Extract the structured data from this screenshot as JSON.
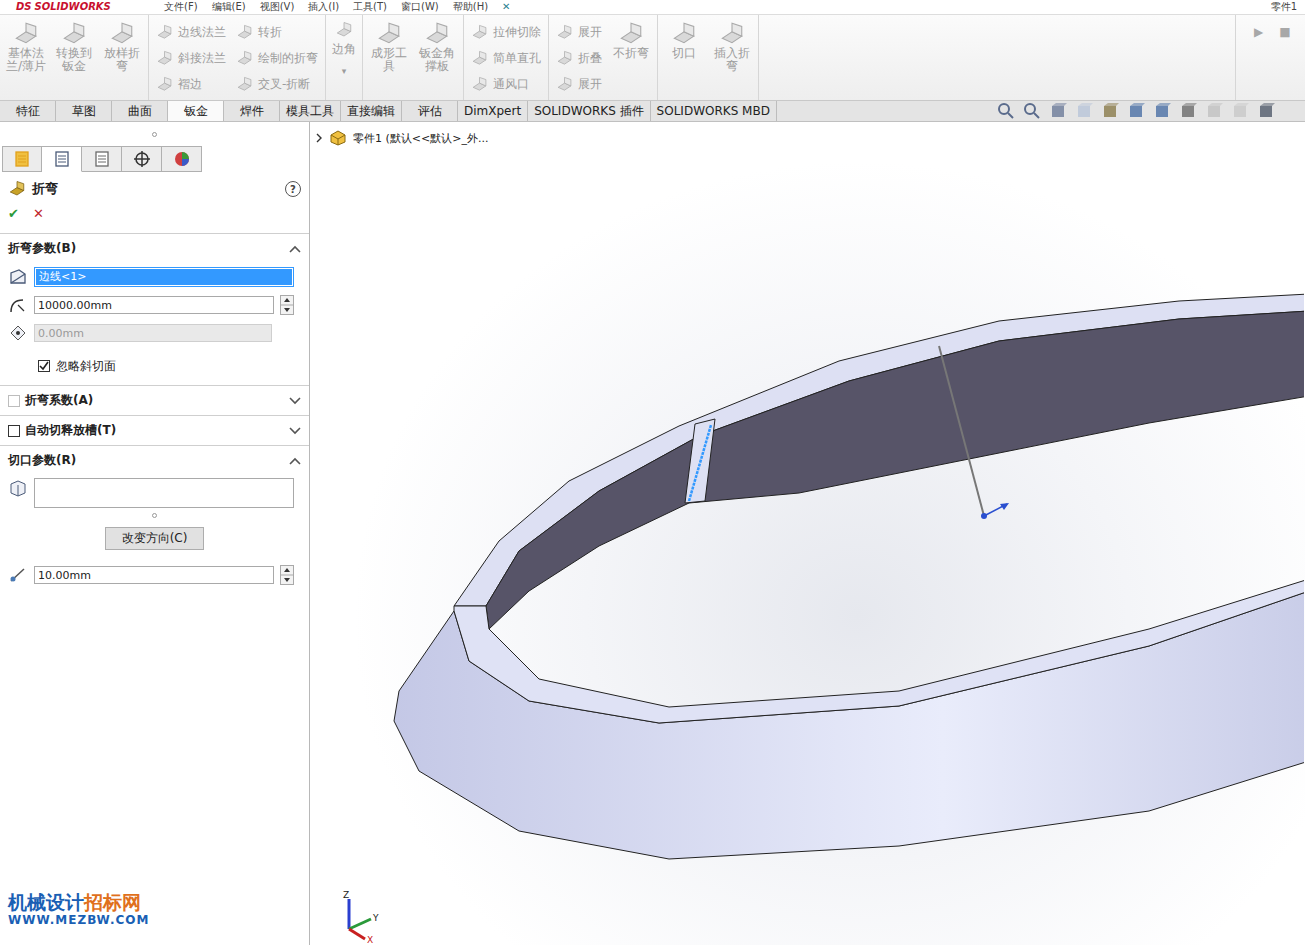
{
  "titlebar": {
    "logo_mark": "DS",
    "logo": "SOLIDWORKS",
    "menu": [
      "文件(F)",
      "编辑(E)",
      "视图(V)",
      "插入(I)",
      "工具(T)",
      "窗口(W)",
      "帮助(H)"
    ],
    "pin": "✕",
    "document": "零件1"
  },
  "ribbon": {
    "sections": [
      [
        {
          "kind": "large",
          "label": "基体法兰/薄片",
          "disabled": true
        },
        {
          "kind": "large",
          "label": "转换到钣金",
          "disabled": true
        },
        {
          "kind": "large",
          "label": "放样折弯",
          "disabled": true
        }
      ],
      [
        {
          "kind": "stack",
          "items": [
            {
              "label": "边线法兰",
              "disabled": true
            },
            {
              "label": "斜接法兰",
              "disabled": true
            },
            {
              "label": "褶边",
              "disabled": true
            }
          ]
        },
        {
          "kind": "stack",
          "items": [
            {
              "label": "转折",
              "disabled": true
            },
            {
              "label": "绘制的折弯",
              "disabled": true
            },
            {
              "label": "交叉-折断",
              "disabled": true
            }
          ]
        }
      ],
      [
        {
          "kind": "dropdown",
          "label": "边角",
          "arrow": "▾",
          "disabled": true
        }
      ],
      [
        {
          "kind": "large",
          "label": "成形工具",
          "disabled": true
        },
        {
          "kind": "large",
          "label": "钣金角撑板",
          "disabled": true
        }
      ],
      [
        {
          "kind": "stack",
          "items": [
            {
              "label": "拉伸切除",
              "disabled": true
            },
            {
              "label": "简单直孔",
              "disabled": true
            },
            {
              "label": "通风口",
              "disabled": true
            }
          ]
        }
      ],
      [
        {
          "kind": "stack",
          "items": [
            {
              "label": "展开",
              "disabled": true
            },
            {
              "label": "折叠",
              "disabled": true
            },
            {
              "label": "展开",
              "disabled": true
            }
          ]
        },
        {
          "kind": "large",
          "label": "不折弯",
          "disabled": true
        }
      ],
      [
        {
          "kind": "large",
          "label": "切口",
          "disabled": true
        },
        {
          "kind": "large",
          "label": "插入折弯",
          "disabled": true
        }
      ]
    ],
    "macro": {
      "play": "▶",
      "stop": "■"
    }
  },
  "tabs": [
    {
      "label": "特征",
      "selected": false
    },
    {
      "label": "草图",
      "selected": false
    },
    {
      "label": "曲面",
      "selected": false
    },
    {
      "label": "钣金",
      "selected": true
    },
    {
      "label": "焊件",
      "selected": false
    },
    {
      "label": "模具工具",
      "selected": false
    },
    {
      "label": "直接编辑",
      "selected": false
    },
    {
      "label": "评估",
      "selected": false
    },
    {
      "label": "DimXpert",
      "selected": false
    },
    {
      "label": "SOLIDWORKS 插件",
      "selected": false
    },
    {
      "label": "SOLIDWORKS MBD",
      "selected": false
    }
  ],
  "property_manager": {
    "tabs": [
      {
        "selected": false
      },
      {
        "selected": true
      },
      {
        "selected": false
      },
      {
        "selected": false
      },
      {
        "selected": false
      }
    ],
    "title": "折弯",
    "help": "?",
    "ok": "✔",
    "cancel": "✕",
    "sections": [
      {
        "title": "折弯参数(B)",
        "kind": "plain",
        "expanded": true,
        "fields": [
          {
            "kind": "selection",
            "value": "边线<1>",
            "selected": true
          },
          {
            "kind": "spinner",
            "value": "10000.00mm"
          },
          {
            "kind": "readonly",
            "value": "0.00mm",
            "disabled": true
          },
          {
            "kind": "checkbox",
            "label": "忽略斜切面",
            "checked": true
          }
        ]
      },
      {
        "title": "折弯系数(A)",
        "kind": "checkbox",
        "checked": false,
        "disabled": true,
        "expanded": false,
        "fields": []
      },
      {
        "title": "自动切释放槽(T)",
        "kind": "checkbox",
        "checked": false,
        "disabled": false,
        "expanded": false,
        "fields": []
      },
      {
        "title": "切口参数(R)",
        "kind": "plain",
        "expanded": true,
        "fields": [
          {
            "kind": "list",
            "value": ""
          },
          {
            "kind": "button",
            "label": "改变方向(C)"
          },
          {
            "kind": "spinner",
            "value": "10.00mm"
          }
        ]
      }
    ]
  },
  "viewport": {
    "tree_item": "零件1  (默认<<默认>_外...",
    "triad": {
      "x": "X",
      "y": "Y",
      "z": "Z"
    }
  },
  "watermark": {
    "parts": [
      {
        "text": "机械设计",
        "color": "#1a5fb4"
      },
      {
        "text": "招标网",
        "color": "#e0701c"
      }
    ],
    "url": "WWW.MEZBW.COM"
  }
}
